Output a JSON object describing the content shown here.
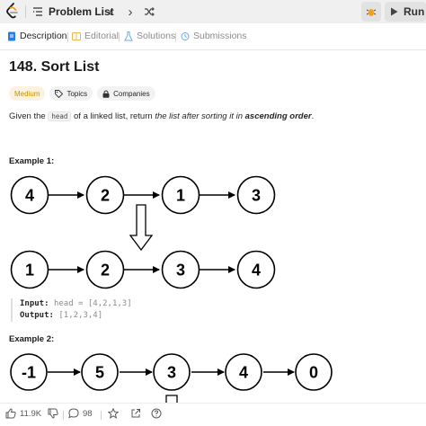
{
  "topbar": {
    "problem_list_label": "Problem List",
    "run_label": "Run"
  },
  "tabs": [
    {
      "label": "Description",
      "active": true
    },
    {
      "label": "Editorial",
      "active": false
    },
    {
      "label": "Solutions",
      "active": false
    },
    {
      "label": "Submissions",
      "active": false
    }
  ],
  "problem": {
    "title": "148. Sort List",
    "difficulty": "Medium",
    "topics_label": "Topics",
    "companies_label": "Companies",
    "desc_pre": "Given the ",
    "desc_code": "head",
    "desc_mid": " of a linked list, return ",
    "desc_em": "the list after sorting it in ",
    "desc_bold": "ascending order",
    "desc_end": "."
  },
  "example1": {
    "label": "Example 1:",
    "input_nodes": [
      "4",
      "2",
      "1",
      "3"
    ],
    "output_nodes": [
      "1",
      "2",
      "3",
      "4"
    ],
    "input_key": "Input:",
    "input_val": "head = [4,2,1,3]",
    "output_key": "Output:",
    "output_val": "[1,2,3,4]"
  },
  "example2": {
    "label": "Example 2:",
    "input_nodes": [
      "-1",
      "5",
      "3",
      "4",
      "0"
    ]
  },
  "bottombar": {
    "likes": "11.9K",
    "comments": "98"
  },
  "colors": {
    "medium": "#c79100",
    "accent": "#262626"
  }
}
